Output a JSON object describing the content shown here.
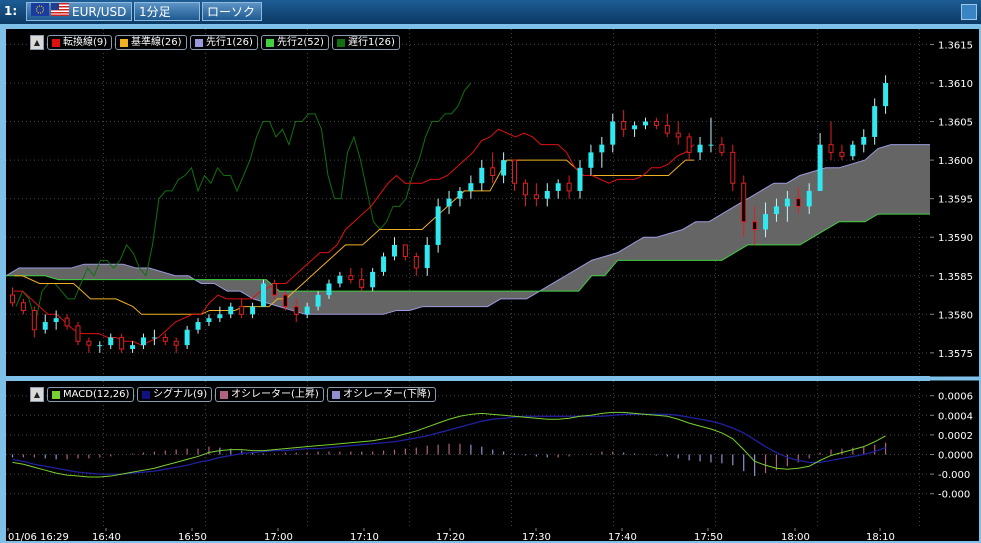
{
  "toolbar": {
    "index_label": "1:",
    "pair": "EUR/USD",
    "timeframe": "1分足",
    "chart_type": "ローソク"
  },
  "colors": {
    "tenkan": "#e01010",
    "kijun": "#f0b020",
    "senkou1": "#9a9ade",
    "senkou2": "#40d040",
    "chikou": "#107010",
    "bull": "#30e8f0",
    "bear": "#e02020",
    "cloud": "#6a6a6a",
    "macd": "#7ad030",
    "signal": "#2020a0",
    "osc_up": "#b06080",
    "osc_down": "#9090d0"
  },
  "price_legend": [
    {
      "label": "転換線(9)",
      "color": "#e01010",
      "name": "tenkan"
    },
    {
      "label": "基準線(26)",
      "color": "#f0b020",
      "name": "kijun"
    },
    {
      "label": "先行1(26)",
      "color": "#9a9ade",
      "name": "senkou1"
    },
    {
      "label": "先行2(52)",
      "color": "#40d040",
      "name": "senkou2"
    },
    {
      "label": "遅行1(26)",
      "color": "#107010",
      "name": "chikou"
    }
  ],
  "macd_legend": [
    {
      "label": "MACD(12,26)",
      "color": "#7ad030",
      "name": "macd"
    },
    {
      "label": "シグナル(9)",
      "color": "#101080",
      "name": "signal"
    },
    {
      "label": "オシレーター(上昇)",
      "color": "#b06080",
      "name": "osc-up"
    },
    {
      "label": "オシレーター(下降)",
      "color": "#9090d0",
      "name": "osc-down"
    }
  ],
  "chart_data": [
    {
      "type": "candlestick",
      "ylim": [
        1.3572,
        1.3617
      ],
      "y_ticks": [
        "1.3615",
        "1.3610",
        "1.3605",
        "1.3600",
        "1.3595",
        "1.3590",
        "1.3585",
        "1.3580",
        "1.3575"
      ],
      "x_ticks": [
        "01/06 16:29",
        "16:40",
        "16:50",
        "17:00",
        "17:10",
        "17:20",
        "17:30",
        "17:40",
        "17:50",
        "18:00",
        "18:10"
      ],
      "candles": [
        [
          1.35825,
          1.35835,
          1.3581,
          1.35815
        ],
        [
          1.35815,
          1.3582,
          1.358,
          1.35805
        ],
        [
          1.35805,
          1.3581,
          1.3577,
          1.3578
        ],
        [
          1.3578,
          1.358,
          1.35775,
          1.3579
        ],
        [
          1.3579,
          1.35805,
          1.3578,
          1.35795
        ],
        [
          1.35795,
          1.358,
          1.3578,
          1.35785
        ],
        [
          1.35785,
          1.3579,
          1.3576,
          1.35765
        ],
        [
          1.35765,
          1.3577,
          1.3575,
          1.3576
        ],
        [
          1.3576,
          1.35765,
          1.3575,
          1.3576
        ],
        [
          1.3576,
          1.35775,
          1.35755,
          1.3577
        ],
        [
          1.3577,
          1.35775,
          1.3575,
          1.35755
        ],
        [
          1.35755,
          1.35765,
          1.3575,
          1.3576
        ],
        [
          1.3576,
          1.35775,
          1.35755,
          1.3577
        ],
        [
          1.3577,
          1.3578,
          1.3576,
          1.3577
        ],
        [
          1.3577,
          1.35775,
          1.3576,
          1.35765
        ],
        [
          1.35765,
          1.3577,
          1.3575,
          1.3576
        ],
        [
          1.3576,
          1.35785,
          1.35755,
          1.3578
        ],
        [
          1.3578,
          1.35795,
          1.35775,
          1.3579
        ],
        [
          1.3579,
          1.358,
          1.35785,
          1.35795
        ],
        [
          1.35795,
          1.3581,
          1.3579,
          1.358
        ],
        [
          1.358,
          1.35815,
          1.35795,
          1.3581
        ],
        [
          1.3581,
          1.3582,
          1.35795,
          1.358
        ],
        [
          1.358,
          1.35815,
          1.35795,
          1.3581
        ],
        [
          1.3581,
          1.35845,
          1.3581,
          1.3584
        ],
        [
          1.3584,
          1.35845,
          1.3582,
          1.35825
        ],
        [
          1.35825,
          1.3583,
          1.35805,
          1.3581
        ],
        [
          1.3581,
          1.3582,
          1.3579,
          1.358
        ],
        [
          1.358,
          1.35815,
          1.35795,
          1.3581
        ],
        [
          1.3581,
          1.3583,
          1.35805,
          1.35825
        ],
        [
          1.35825,
          1.35845,
          1.3582,
          1.3584
        ],
        [
          1.3584,
          1.35855,
          1.35835,
          1.3585
        ],
        [
          1.3585,
          1.3586,
          1.3584,
          1.35845
        ],
        [
          1.35845,
          1.3586,
          1.3583,
          1.35835
        ],
        [
          1.35835,
          1.3586,
          1.3583,
          1.35855
        ],
        [
          1.35855,
          1.3588,
          1.3585,
          1.35875
        ],
        [
          1.35875,
          1.359,
          1.3587,
          1.3589
        ],
        [
          1.3589,
          1.3589,
          1.3587,
          1.35875
        ],
        [
          1.35875,
          1.3588,
          1.3585,
          1.3586
        ],
        [
          1.3586,
          1.359,
          1.3585,
          1.3589
        ],
        [
          1.3589,
          1.3595,
          1.3588,
          1.3594
        ],
        [
          1.3594,
          1.3596,
          1.3593,
          1.3595
        ],
        [
          1.3595,
          1.35965,
          1.3594,
          1.3596
        ],
        [
          1.3596,
          1.3598,
          1.3595,
          1.3597
        ],
        [
          1.3597,
          1.36,
          1.3596,
          1.3599
        ],
        [
          1.3599,
          1.3601,
          1.3597,
          1.3598
        ],
        [
          1.3598,
          1.3601,
          1.3597,
          1.36
        ],
        [
          1.36,
          1.36,
          1.3596,
          1.3597
        ],
        [
          1.3597,
          1.35975,
          1.3594,
          1.35955
        ],
        [
          1.35955,
          1.3597,
          1.3594,
          1.3595
        ],
        [
          1.3595,
          1.3597,
          1.3594,
          1.3596
        ],
        [
          1.3596,
          1.35975,
          1.3595,
          1.3597
        ],
        [
          1.3597,
          1.3598,
          1.3595,
          1.3596
        ],
        [
          1.3596,
          1.36,
          1.3595,
          1.3599
        ],
        [
          1.3599,
          1.3602,
          1.3598,
          1.3601
        ],
        [
          1.3601,
          1.3603,
          1.3599,
          1.3602
        ],
        [
          1.3602,
          1.3606,
          1.3601,
          1.3605
        ],
        [
          1.3605,
          1.36065,
          1.3603,
          1.3604
        ],
        [
          1.3604,
          1.3605,
          1.3603,
          1.36045
        ],
        [
          1.36045,
          1.36055,
          1.3604,
          1.3605
        ],
        [
          1.3605,
          1.36055,
          1.3604,
          1.36045
        ],
        [
          1.36045,
          1.3606,
          1.3603,
          1.36035
        ],
        [
          1.36035,
          1.3605,
          1.3602,
          1.3603
        ],
        [
          1.3603,
          1.36035,
          1.36,
          1.3601
        ],
        [
          1.3601,
          1.3603,
          1.36,
          1.3602
        ],
        [
          1.3602,
          1.36055,
          1.3601,
          1.3602
        ],
        [
          1.3602,
          1.3603,
          1.36005,
          1.3601
        ],
        [
          1.3601,
          1.3602,
          1.3596,
          1.3597
        ],
        [
          1.3597,
          1.3598,
          1.359,
          1.3592
        ],
        [
          1.3592,
          1.3594,
          1.3589,
          1.3591
        ],
        [
          1.3591,
          1.35945,
          1.359,
          1.3593
        ],
        [
          1.3593,
          1.3595,
          1.3592,
          1.3594
        ],
        [
          1.3594,
          1.3596,
          1.3592,
          1.3595
        ],
        [
          1.3595,
          1.35965,
          1.3593,
          1.3594
        ],
        [
          1.3594,
          1.3597,
          1.3593,
          1.3596
        ],
        [
          1.3596,
          1.36035,
          1.3596,
          1.3602
        ],
        [
          1.3602,
          1.3605,
          1.36,
          1.3601
        ],
        [
          1.3601,
          1.3602,
          1.36,
          1.36005
        ],
        [
          1.36005,
          1.36025,
          1.36,
          1.3602
        ],
        [
          1.3602,
          1.3604,
          1.3601,
          1.3603
        ],
        [
          1.3603,
          1.3608,
          1.3602,
          1.3607
        ],
        [
          1.3607,
          1.3611,
          1.3606,
          1.361
        ]
      ],
      "tenkan": [
        1.3583,
        1.3583,
        1.3582,
        1.3581,
        1.358,
        1.358,
        1.3579,
        1.3578,
        1.35775,
        1.35775,
        1.35775,
        1.3577,
        1.3577,
        1.35765,
        1.35765,
        1.3576,
        1.35765,
        1.3577,
        1.3578,
        1.3579,
        1.35795,
        1.358,
        1.358,
        1.35815,
        1.35825,
        1.3582,
        1.3582,
        1.3582,
        1.3582,
        1.3583,
        1.35835,
        1.3584,
        1.3584,
        1.3585,
        1.3586,
        1.3587,
        1.3588,
        1.3588,
        1.3589,
        1.3591,
        1.3592,
        1.3593,
        1.3594,
        1.35955,
        1.3597,
        1.3598,
        1.3597,
        1.3597,
        1.3597,
        1.35975,
        1.35975,
        1.3598,
        1.3599,
        1.36,
        1.3601,
        1.36025,
        1.3603,
        1.3604,
        1.36035,
        1.3603,
        1.36035,
        1.3603,
        1.3602,
        1.3602,
        1.3602,
        1.3601,
        1.3599,
        1.3598,
        1.3598,
        1.35975,
        1.3597,
        1.35975,
        1.35975,
        1.35975,
        1.3598,
        1.3599,
        1.3599,
        1.35995,
        1.36005,
        1.3601,
        1.3602
      ],
      "kijun": [
        1.3585,
        1.3585,
        1.35845,
        1.3584,
        1.3584,
        1.3584,
        1.3584,
        1.3584,
        1.3583,
        1.3582,
        1.3582,
        1.3582,
        1.3582,
        1.35815,
        1.3581,
        1.358,
        1.358,
        1.358,
        1.358,
        1.358,
        1.358,
        1.358,
        1.358,
        1.35805,
        1.35805,
        1.35805,
        1.35805,
        1.3581,
        1.3581,
        1.3581,
        1.3581,
        1.3582,
        1.3582,
        1.3583,
        1.3584,
        1.3585,
        1.3586,
        1.3587,
        1.3588,
        1.3589,
        1.3589,
        1.3589,
        1.359,
        1.3591,
        1.3591,
        1.3591,
        1.3591,
        1.3591,
        1.3591,
        1.3592,
        1.3593,
        1.3594,
        1.3595,
        1.3596,
        1.3596,
        1.3596,
        1.3596,
        1.3598,
        1.36,
        1.36,
        1.36,
        1.36,
        1.36,
        1.36,
        1.36,
        1.36,
        1.3599,
        1.3598,
        1.3598,
        1.3598,
        1.3598,
        1.3598,
        1.3598,
        1.3598,
        1.3598,
        1.3598,
        1.3598,
        1.3598,
        1.3599,
        1.36,
        1.36
      ],
      "senkou1": [
        1.3585,
        1.3586,
        1.3586,
        1.3586,
        1.3586,
        1.3586,
        1.35865,
        1.35865,
        1.35865,
        1.35865,
        1.3586,
        1.3586,
        1.35855,
        1.3585,
        1.3585,
        1.3584,
        1.3584,
        1.3583,
        1.3583,
        1.3582,
        1.35815,
        1.3581,
        1.35805,
        1.358,
        1.358,
        1.358,
        1.358,
        1.358,
        1.358,
        1.358,
        1.35805,
        1.35805,
        1.3581,
        1.3581,
        1.3581,
        1.3581,
        1.3581,
        1.3581,
        1.3582,
        1.3582,
        1.3582,
        1.3583,
        1.3584,
        1.3585,
        1.3586,
        1.3587,
        1.35875,
        1.3588,
        1.3589,
        1.359,
        1.359,
        1.35905,
        1.3591,
        1.3592,
        1.3592,
        1.3593,
        1.3594,
        1.3595,
        1.3596,
        1.3597,
        1.3597,
        1.3598,
        1.35985,
        1.3599,
        1.3599,
        1.35995,
        1.36,
        1.36015,
        1.3602,
        1.3602,
        1.3602,
        1.3602
      ],
      "senkou2": [
        1.3585,
        1.3585,
        1.3585,
        1.3585,
        1.35845,
        1.35845,
        1.35845,
        1.35845,
        1.35845,
        1.35845,
        1.35845,
        1.35845,
        1.35845,
        1.35845,
        1.35845,
        1.35845,
        1.35845,
        1.35845,
        1.35845,
        1.35845,
        1.35845,
        1.3583,
        1.3583,
        1.3583,
        1.3583,
        1.3583,
        1.3583,
        1.3583,
        1.3583,
        1.3583,
        1.3583,
        1.3583,
        1.3583,
        1.3583,
        1.3583,
        1.3583,
        1.3583,
        1.3583,
        1.3583,
        1.3583,
        1.3583,
        1.3583,
        1.3583,
        1.3583,
        1.3583,
        1.3585,
        1.3585,
        1.3587,
        1.3587,
        1.3587,
        1.3587,
        1.3587,
        1.3587,
        1.3587,
        1.3587,
        1.3587,
        1.3588,
        1.3589,
        1.3589,
        1.3589,
        1.3589,
        1.3589,
        1.359,
        1.3591,
        1.3592,
        1.3592,
        1.3592,
        1.3593,
        1.3593,
        1.3593,
        1.3593,
        1.3593
      ],
      "chikou": [
        1.3581,
        1.3583,
        1.3582,
        1.3579,
        1.3583,
        1.3584,
        1.3584,
        1.3583,
        1.3582,
        1.3582,
        1.3584,
        1.3586,
        1.3585,
        1.3587,
        1.3587,
        1.3586,
        1.3587,
        1.3589,
        1.3588,
        1.3586,
        1.3585,
        1.3589,
        1.3595,
        1.3596,
        1.3596,
        1.35975,
        1.3598,
        1.3599,
        1.3596,
        1.3598,
        1.3597,
        1.3599,
        1.3598,
        1.3598,
        1.3596,
        1.3598,
        1.36,
        1.3603,
        1.3605,
        1.3605,
        1.3603,
        1.3604,
        1.3602,
        1.3605,
        1.3605,
        1.3606,
        1.3606,
        1.3604,
        1.3598,
        1.3595,
        1.3595,
        1.3601,
        1.3603,
        1.36,
        1.3596,
        1.3592,
        1.3591,
        1.3592,
        1.3594,
        1.3594,
        1.3595,
        1.3598,
        1.36,
        1.3603,
        1.3605,
        1.3605,
        1.3606,
        1.3606,
        1.3607,
        1.3609,
        1.361
      ]
    },
    {
      "type": "line",
      "ylim": [
        -0.00075,
        0.00075
      ],
      "y_ticks": [
        "0.0006",
        "0.0004",
        "0.0002",
        "0.0000",
        "-0.000",
        "-0.000"
      ],
      "macd": [
        -8e-05,
        -0.0001,
        -0.00013,
        -0.00016,
        -0.00019,
        -0.00021,
        -0.00022,
        -0.00023,
        -0.00023,
        -0.00022,
        -0.0002,
        -0.00018,
        -0.00016,
        -0.00014,
        -0.00011,
        -8e-05,
        -5e-05,
        -2e-05,
        2e-05,
        4e-05,
        5e-05,
        5e-05,
        4e-05,
        4e-05,
        5e-05,
        6e-05,
        7e-05,
        8e-05,
        9e-05,
        0.0001,
        0.00011,
        0.00012,
        0.00013,
        0.00014,
        0.00016,
        0.00018,
        0.00021,
        0.00024,
        0.00028,
        0.00032,
        0.00036,
        0.00039,
        0.00041,
        0.00042,
        0.00041,
        0.0004,
        0.00039,
        0.00038,
        0.00037,
        0.00036,
        0.00036,
        0.00037,
        0.00039,
        0.0004,
        0.00042,
        0.00043,
        0.00043,
        0.00042,
        0.00041,
        0.0004,
        0.00039,
        0.00036,
        0.00032,
        0.00029,
        0.00026,
        0.00022,
        0.00016,
        5e-05,
        -7e-05,
        -0.00011,
        -0.00014,
        -0.00015,
        -0.00014,
        -0.00012,
        -6e-05,
        -1e-05,
        2e-05,
        5e-05,
        8e-05,
        0.00013,
        0.00019
      ],
      "signal": [
        -5e-05,
        -7e-05,
        -0.0001,
        -0.00012,
        -0.00014,
        -0.00016,
        -0.00018,
        -0.00019,
        -0.0002,
        -0.0002,
        -0.0002,
        -0.00019,
        -0.00018,
        -0.00017,
        -0.00015,
        -0.00013,
        -0.00011,
        -8e-05,
        -6e-05,
        -3e-05,
        -1e-05,
        1e-05,
        2e-05,
        3e-05,
        4e-05,
        4e-05,
        5e-05,
        6e-05,
        6e-05,
        7e-05,
        8e-05,
        9e-05,
        0.0001,
        0.00011,
        0.00012,
        0.00013,
        0.00015,
        0.00017,
        0.00019,
        0.00022,
        0.00025,
        0.00028,
        0.00031,
        0.00034,
        0.00036,
        0.00037,
        0.00038,
        0.00039,
        0.00039,
        0.00039,
        0.00039,
        0.00039,
        0.00039,
        0.00039,
        0.00039,
        0.0004,
        0.00041,
        0.00041,
        0.00041,
        0.00041,
        0.00041,
        0.0004,
        0.00038,
        0.00036,
        0.00034,
        0.00031,
        0.00027,
        0.00022,
        0.00015,
        8e-05,
        2e-05,
        -3e-05,
        -6e-05,
        -8e-05,
        -8e-05,
        -6e-05,
        -4e-05,
        -2e-05,
        0.0,
        3e-05,
        7e-05
      ],
      "oscillator": [
        -3e-05,
        -3e-05,
        -3e-05,
        -4e-05,
        -5e-05,
        -5e-05,
        -4e-05,
        -4e-05,
        -3e-05,
        -2e-05,
        0.0,
        1e-05,
        2e-05,
        3e-05,
        4e-05,
        5e-05,
        6e-05,
        6e-05,
        8e-05,
        7e-05,
        6e-05,
        4e-05,
        2e-05,
        1e-05,
        1e-05,
        2e-05,
        2e-05,
        2e-05,
        3e-05,
        3e-05,
        3e-05,
        3e-05,
        3e-05,
        3e-05,
        4e-05,
        5e-05,
        6e-05,
        7e-05,
        9e-05,
        0.0001,
        0.00011,
        0.00011,
        0.0001,
        8e-05,
        5e-05,
        3e-05,
        1e-05,
        -1e-05,
        -2e-05,
        -3e-05,
        -3e-05,
        -2e-05,
        0.0,
        1e-05,
        3e-05,
        3e-05,
        2e-05,
        1e-05,
        0.0,
        -1e-05,
        -2e-05,
        -4e-05,
        -6e-05,
        -7e-05,
        -8e-05,
        -9e-05,
        -0.00011,
        -0.00017,
        -0.00022,
        -0.00019,
        -0.00016,
        -0.00012,
        -8e-05,
        -4e-05,
        2e-05,
        5e-05,
        6e-05,
        7e-05,
        8e-05,
        0.0001,
        0.00012
      ]
    }
  ]
}
